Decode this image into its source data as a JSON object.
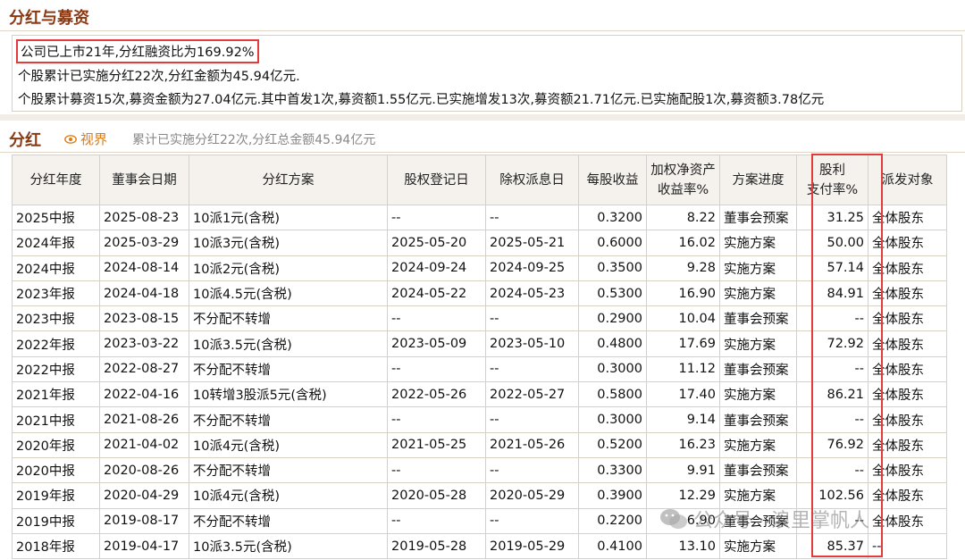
{
  "top": {
    "title": "分红与募资",
    "summary_line1": "公司已上市21年,分红融资比为169.92%",
    "summary_line2": "个股累计已实施分红22次,分红金额为45.94亿元.",
    "summary_line3": "个股累计募资15次,募资金额为27.04亿元.其中首发1次,募资额1.55亿元.已实施增发13次,募资额21.71亿元.已实施配股1次,募资额3.78亿元"
  },
  "section": {
    "title": "分红",
    "view_label": "视界",
    "subtitle": "累计已实施分红22次,分红总金额45.94亿元"
  },
  "table": {
    "headers": [
      "分红年度",
      "董事会日期",
      "分红方案",
      "股权登记日",
      "除权派息日",
      "每股收益",
      "加权净资产\n收益率%",
      "方案进度",
      "股利\n支付率%",
      "派发对象"
    ],
    "rows": [
      [
        "2025中报",
        "2025-08-23",
        "10派1元(含税)",
        "--",
        "--",
        "0.3200",
        "8.22",
        "董事会预案",
        "31.25",
        "全体股东"
      ],
      [
        "2024年报",
        "2025-03-29",
        "10派3元(含税)",
        "2025-05-20",
        "2025-05-21",
        "0.6000",
        "16.02",
        "实施方案",
        "50.00",
        "全体股东"
      ],
      [
        "2024中报",
        "2024-08-14",
        "10派2元(含税)",
        "2024-09-24",
        "2024-09-25",
        "0.3500",
        "9.28",
        "实施方案",
        "57.14",
        "全体股东"
      ],
      [
        "2023年报",
        "2024-04-18",
        "10派4.5元(含税)",
        "2024-05-22",
        "2024-05-23",
        "0.5300",
        "16.90",
        "实施方案",
        "84.91",
        "全体股东"
      ],
      [
        "2023中报",
        "2023-08-15",
        "不分配不转增",
        "--",
        "--",
        "0.2900",
        "10.04",
        "董事会预案",
        "--",
        "全体股东"
      ],
      [
        "2022年报",
        "2023-03-22",
        "10派3.5元(含税)",
        "2023-05-09",
        "2023-05-10",
        "0.4800",
        "17.69",
        "实施方案",
        "72.92",
        "全体股东"
      ],
      [
        "2022中报",
        "2022-08-27",
        "不分配不转增",
        "--",
        "--",
        "0.3000",
        "11.12",
        "董事会预案",
        "--",
        "全体股东"
      ],
      [
        "2021年报",
        "2022-04-16",
        "10转增3股派5元(含税)",
        "2022-05-26",
        "2022-05-27",
        "0.5800",
        "17.40",
        "实施方案",
        "86.21",
        "全体股东"
      ],
      [
        "2021中报",
        "2021-08-26",
        "不分配不转增",
        "--",
        "--",
        "0.3000",
        "9.14",
        "董事会预案",
        "--",
        "全体股东"
      ],
      [
        "2020年报",
        "2021-04-02",
        "10派4元(含税)",
        "2021-05-25",
        "2021-05-26",
        "0.5200",
        "16.23",
        "实施方案",
        "76.92",
        "全体股东"
      ],
      [
        "2020中报",
        "2020-08-26",
        "不分配不转增",
        "--",
        "--",
        "0.3300",
        "9.91",
        "董事会预案",
        "--",
        "全体股东"
      ],
      [
        "2019年报",
        "2020-04-29",
        "10派4元(含税)",
        "2020-05-28",
        "2020-05-29",
        "0.3900",
        "12.29",
        "实施方案",
        "102.56",
        "全体股东"
      ],
      [
        "2019中报",
        "2019-08-17",
        "不分配不转增",
        "--",
        "--",
        "0.2200",
        "6.90",
        "董事会预案",
        "--",
        "全体股东"
      ],
      [
        "2018年报",
        "2019-04-17",
        "10派3.5元(含税)",
        "2019-05-28",
        "2019-05-29",
        "0.4100",
        "13.10",
        "实施方案",
        "85.37",
        "--"
      ]
    ]
  },
  "watermark": {
    "text": "公众号 · 浪里掌帆人"
  },
  "colors": {
    "title": "#8a3a13",
    "accent": "#e07b12",
    "highlight": "#e23b3b",
    "header_bg": "#f5f2ee",
    "border": "#d9d0c4"
  },
  "icons": {
    "view": "eye-icon",
    "watermark": "wechat-icon"
  }
}
